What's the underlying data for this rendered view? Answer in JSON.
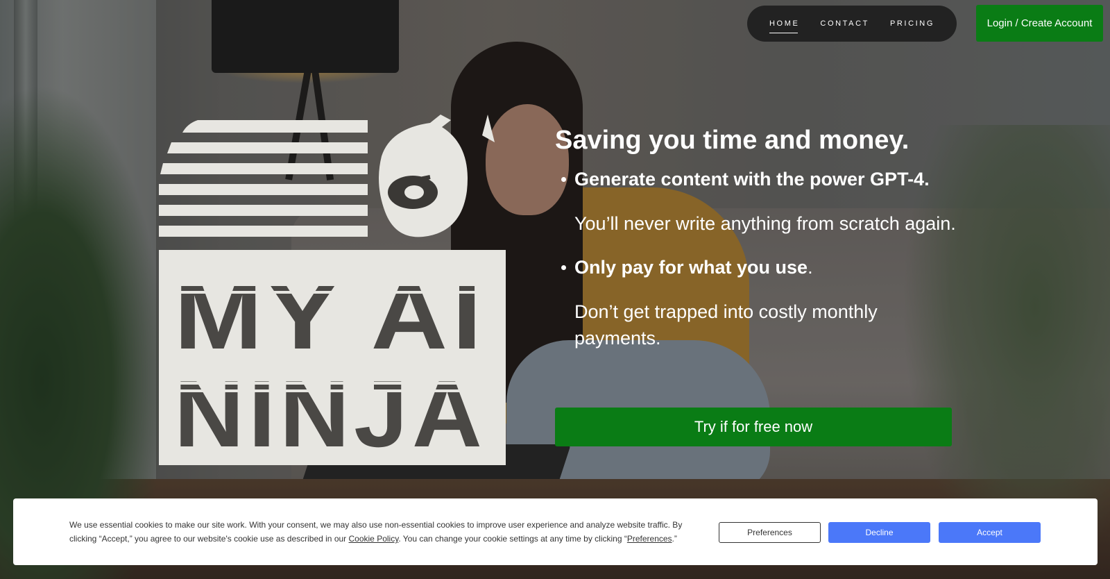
{
  "nav": {
    "items": [
      {
        "label": "HOME",
        "active": true
      },
      {
        "label": "CONTACT",
        "active": false
      },
      {
        "label": "PRICING",
        "active": false
      }
    ],
    "login_label": "Login / Create Account"
  },
  "logo": {
    "line1": "MY AI",
    "line2": "NINJA"
  },
  "hero": {
    "title": "Saving you time and money.",
    "features": [
      {
        "heading": "Generate content with the power GPT-4.",
        "heading_suffix": "",
        "description": "You’ll never write anything from scratch again."
      },
      {
        "heading": "Only pay for what you use",
        "heading_suffix": ".",
        "description": "Don’t get trapped into costly monthly payments."
      }
    ],
    "cta_label": "Try if for free now"
  },
  "cookie": {
    "text_part1": "We use essential cookies to make our site work. With your consent, we may also use non-essential cookies to improve user experience and analyze website traffic. By clicking “Accept,” you agree to our website's cookie use as described in our ",
    "cookie_policy_link": "Cookie Policy",
    "text_part2": ". You can change your cookie settings at any time by clicking “",
    "preferences_link": "Preferences",
    "text_part3": ".”",
    "preferences_button": "Preferences",
    "decline_button": "Decline",
    "accept_button": "Accept"
  },
  "colors": {
    "brand_green": "#0a7c15",
    "nav_bg": "#222222",
    "cookie_blue": "#4b78f9",
    "logo_cream": "#e7e6e1"
  }
}
